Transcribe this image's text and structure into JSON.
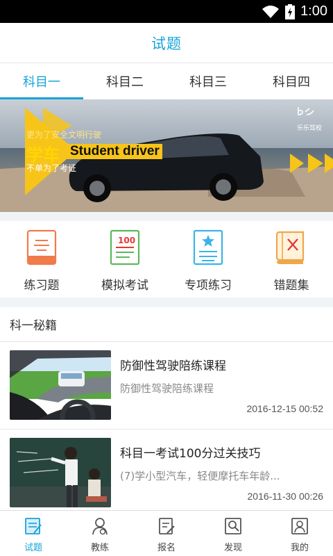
{
  "status_bar": {
    "time": "1:00"
  },
  "header": {
    "title": "试题"
  },
  "tabs": [
    {
      "label": "科目一",
      "active": true
    },
    {
      "label": "科目二",
      "active": false
    },
    {
      "label": "科目三",
      "active": false
    },
    {
      "label": "科目四",
      "active": false
    }
  ],
  "banner": {
    "line1": "更为了安全文明行驶",
    "headline_cn": "学车",
    "headline_en": "Student driver",
    "line2": "不单为了考证",
    "brand_mark": "乐乐驾校"
  },
  "features": [
    {
      "label": "练习题",
      "icon": "notebook-icon",
      "color": "#f07b4b"
    },
    {
      "label": "模拟考试",
      "icon": "exam-paper-icon",
      "color": "#5cb85c"
    },
    {
      "label": "专项练习",
      "icon": "star-document-icon",
      "color": "#3ab4e8"
    },
    {
      "label": "错题集",
      "icon": "wrong-book-icon",
      "color": "#f0a64b"
    }
  ],
  "section": {
    "title": "科一秘籍"
  },
  "articles": [
    {
      "title": "防御性驾驶陪练课程",
      "summary": "防御性驾驶陪练课程",
      "date": "2016-12-15 00:52"
    },
    {
      "title": "科目一考试100分过关技巧",
      "summary": "(7)学小型汽车，轻便摩托车年龄...",
      "date": "2016-11-30 00:26"
    }
  ],
  "bottom_nav": [
    {
      "label": "试题",
      "active": true
    },
    {
      "label": "教练",
      "active": false
    },
    {
      "label": "报名",
      "active": false
    },
    {
      "label": "发现",
      "active": false
    },
    {
      "label": "我的",
      "active": false
    }
  ],
  "colors": {
    "accent": "#17a4d8",
    "banner_yellow": "#f7c419"
  }
}
